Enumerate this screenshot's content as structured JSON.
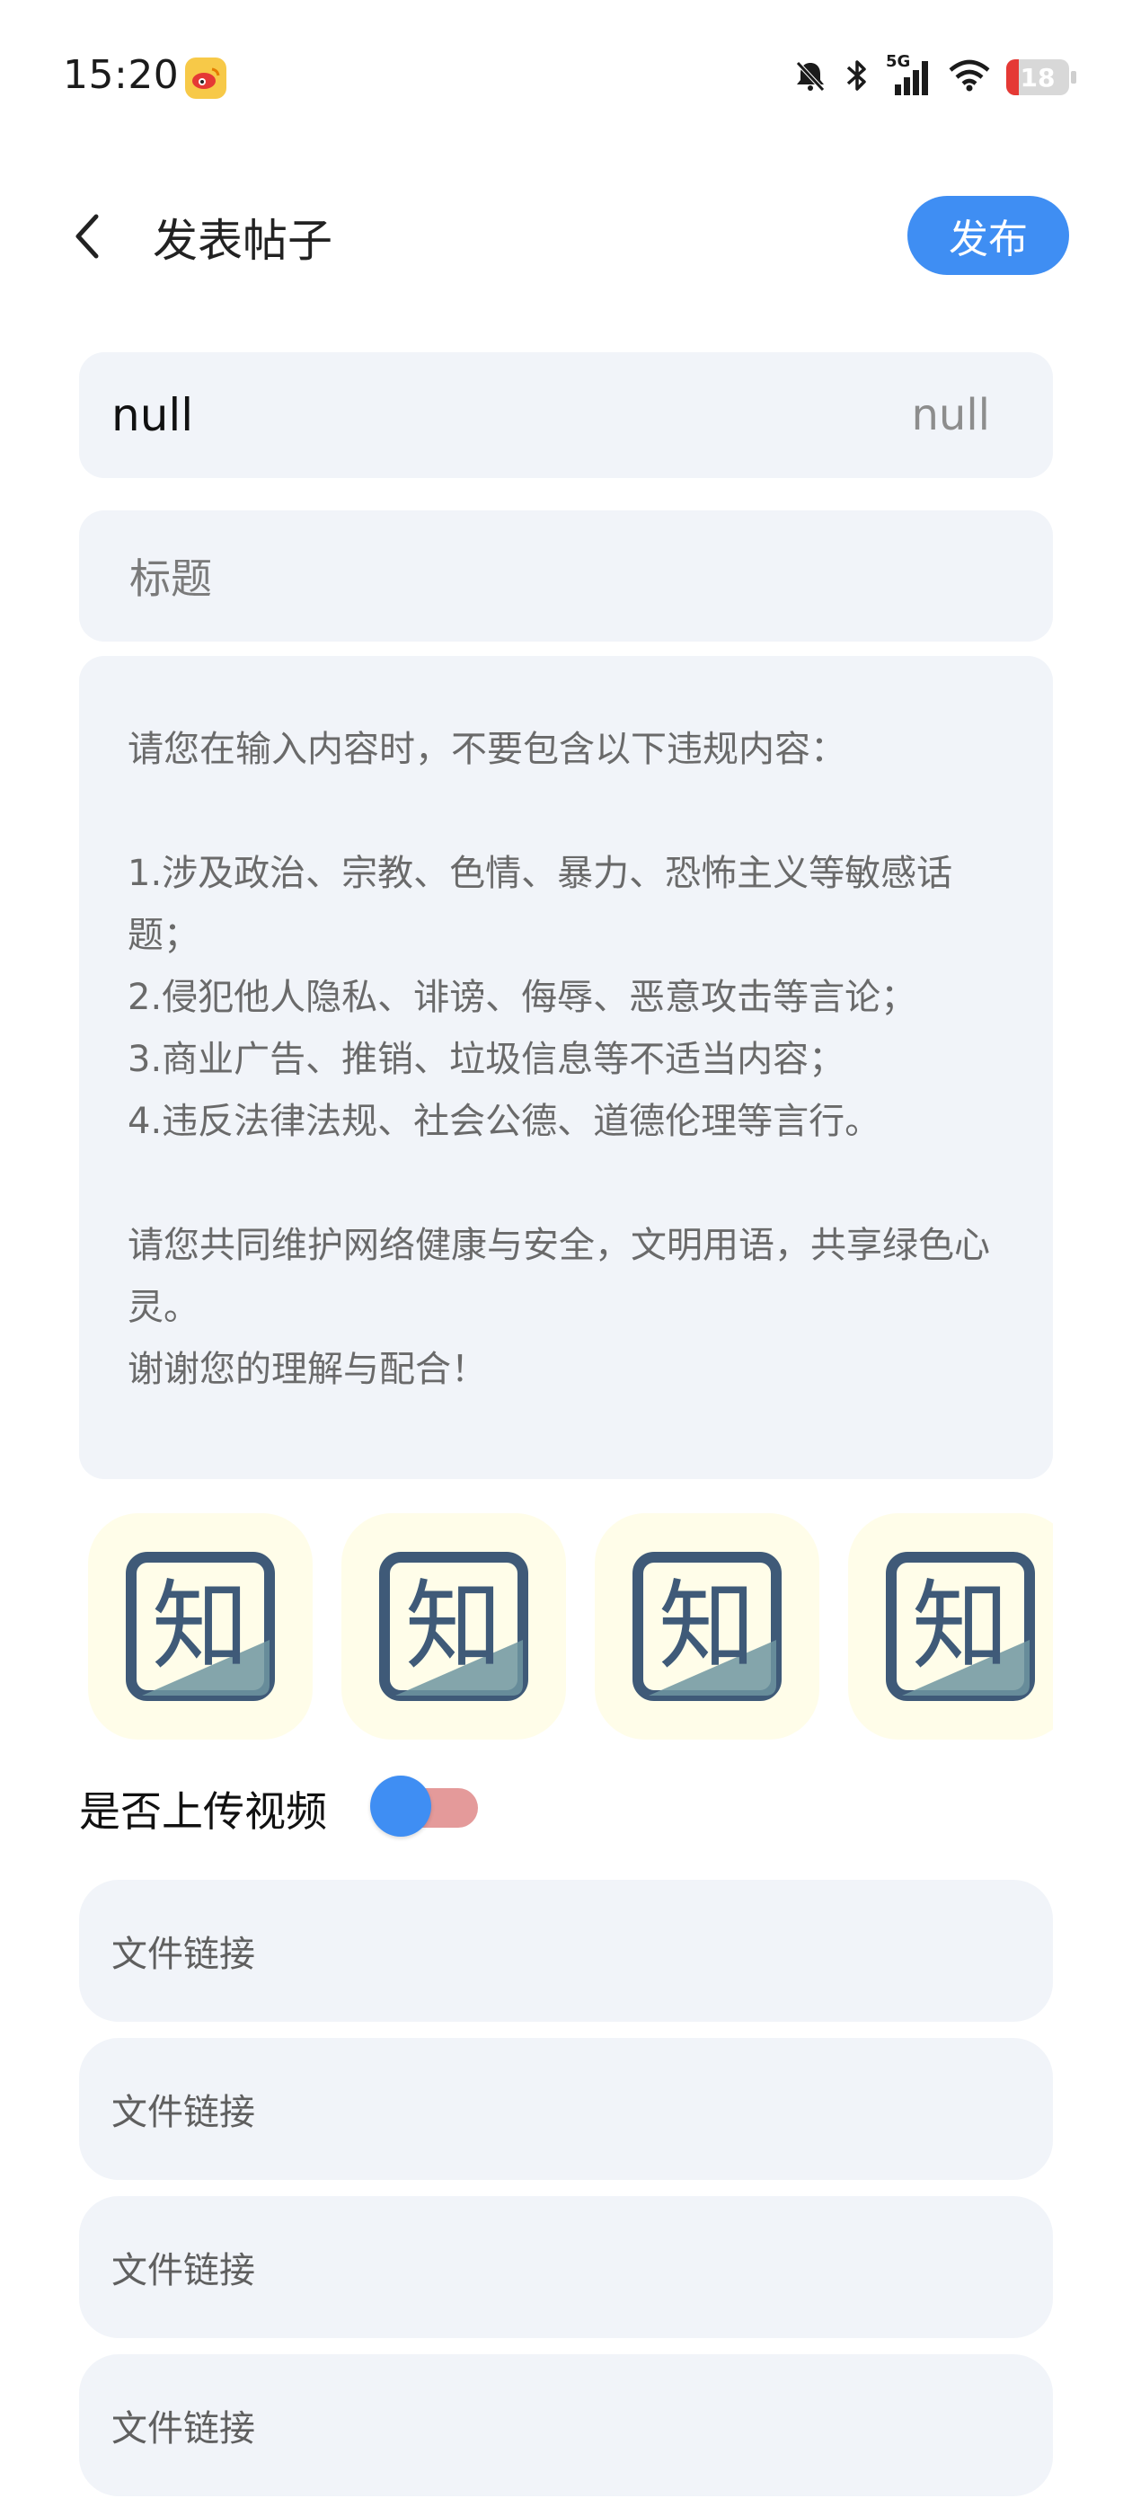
{
  "status_bar": {
    "time": "15:20",
    "network": "5G",
    "battery": "18",
    "icons": [
      "weibo-icon",
      "mute-bell-icon",
      "bluetooth-icon",
      "signal-icon",
      "wifi-icon",
      "battery-icon"
    ]
  },
  "header": {
    "title": "发表帖子",
    "publish_label": "发布"
  },
  "fields": {
    "category_left": "null",
    "category_right": "null",
    "title_placeholder": "标题",
    "content_placeholder": "请您在输入内容时，不要包含以下违规内容：\n\n1.涉及政治、宗教、色情、暴力、恐怖主义等敏感话题；\n2.侵犯他人隐私、诽谤、侮辱、恶意攻击等言论；\n3.商业广告、推销、垃圾信息等不适当内容；\n4.违反法律法规、社会公德、道德伦理等言行。\n\n请您共同维护网络健康与安全，文明用语，共享绿色心灵。\n谢谢您的理解与配合！"
  },
  "images": [
    {
      "icon": "app-logo-icon"
    },
    {
      "icon": "app-logo-icon"
    },
    {
      "icon": "app-logo-icon"
    },
    {
      "icon": "app-logo-icon"
    }
  ],
  "video_toggle": {
    "label": "是否上传视频",
    "on": true
  },
  "file_links": [
    {
      "placeholder": "文件链接"
    },
    {
      "placeholder": "文件链接"
    },
    {
      "placeholder": "文件链接"
    },
    {
      "placeholder": "文件链接"
    }
  ],
  "colors": {
    "accent": "#3f8ef3",
    "card_bg": "#f1f4f9",
    "toggle_track": "#e49a9a"
  }
}
